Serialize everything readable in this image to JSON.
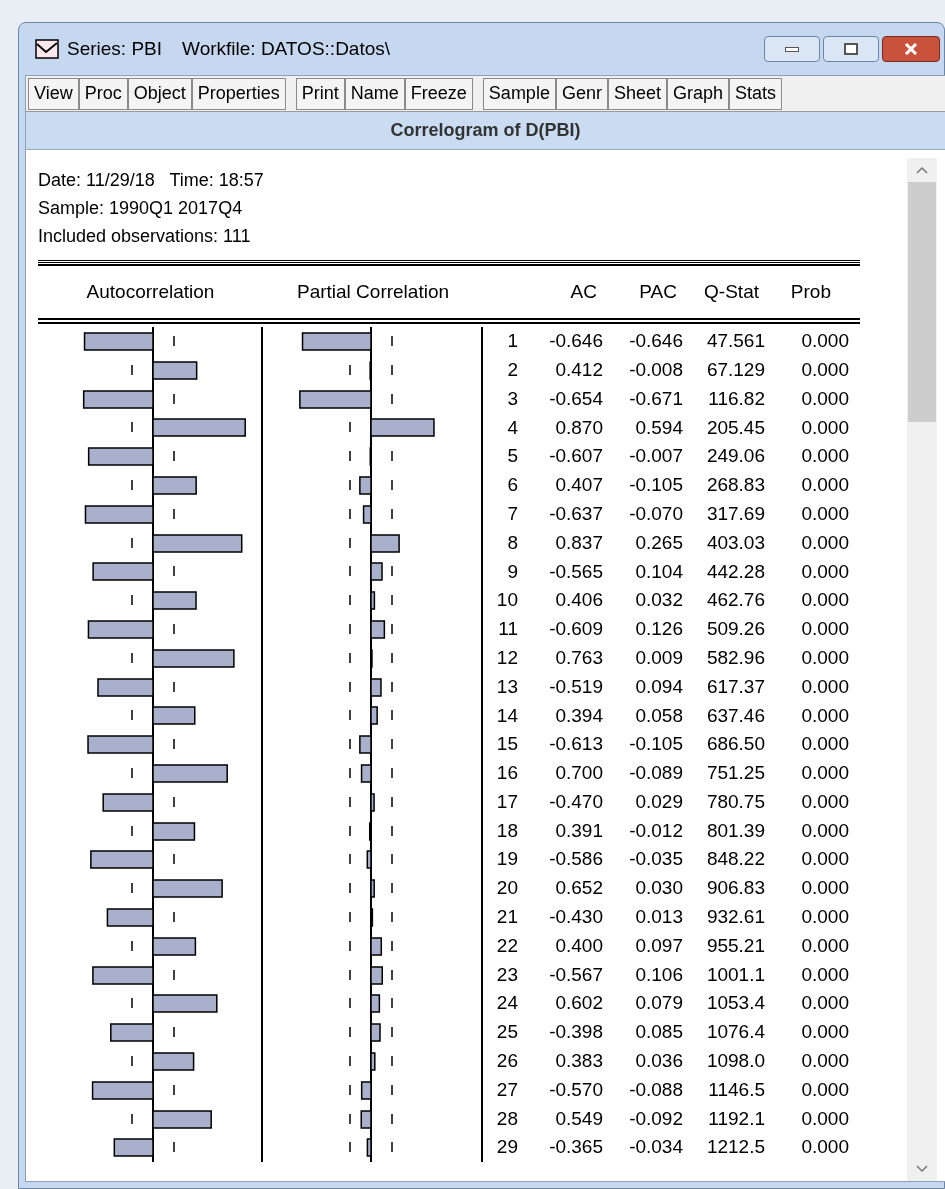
{
  "window": {
    "series": "Series: PBI",
    "workfile": "Workfile: DATOS::Datos\\"
  },
  "toolbar_groups": [
    [
      "View",
      "Proc",
      "Object",
      "Properties"
    ],
    [
      "Print",
      "Name",
      "Freeze"
    ],
    [
      "Sample",
      "Genr",
      "Sheet",
      "Graph",
      "Stats"
    ]
  ],
  "view_title": "Correlogram of D(PBI)",
  "header_lines": [
    "Date: 11/29/18   Time: 18:57",
    "Sample: 1990Q1 2017Q4",
    "Included observations: 111"
  ],
  "columns": [
    "Autocorrelation",
    "Partial Correlation",
    "AC",
    "PAC",
    "Q-Stat",
    "Prob"
  ],
  "rows": [
    {
      "lag": "1",
      "ac": "-0.646",
      "pac": "-0.646",
      "q_stat": "47.561",
      "prob": "0.000"
    },
    {
      "lag": "2",
      "ac": "0.412",
      "pac": "-0.008",
      "q_stat": "67.129",
      "prob": "0.000"
    },
    {
      "lag": "3",
      "ac": "-0.654",
      "pac": "-0.671",
      "q_stat": "116.82",
      "prob": "0.000"
    },
    {
      "lag": "4",
      "ac": "0.870",
      "pac": "0.594",
      "q_stat": "205.45",
      "prob": "0.000"
    },
    {
      "lag": "5",
      "ac": "-0.607",
      "pac": "-0.007",
      "q_stat": "249.06",
      "prob": "0.000"
    },
    {
      "lag": "6",
      "ac": "0.407",
      "pac": "-0.105",
      "q_stat": "268.83",
      "prob": "0.000"
    },
    {
      "lag": "7",
      "ac": "-0.637",
      "pac": "-0.070",
      "q_stat": "317.69",
      "prob": "0.000"
    },
    {
      "lag": "8",
      "ac": "0.837",
      "pac": "0.265",
      "q_stat": "403.03",
      "prob": "0.000"
    },
    {
      "lag": "9",
      "ac": "-0.565",
      "pac": "0.104",
      "q_stat": "442.28",
      "prob": "0.000"
    },
    {
      "lag": "10",
      "ac": "0.406",
      "pac": "0.032",
      "q_stat": "462.76",
      "prob": "0.000"
    },
    {
      "lag": "11",
      "ac": "-0.609",
      "pac": "0.126",
      "q_stat": "509.26",
      "prob": "0.000"
    },
    {
      "lag": "12",
      "ac": "0.763",
      "pac": "0.009",
      "q_stat": "582.96",
      "prob": "0.000"
    },
    {
      "lag": "13",
      "ac": "-0.519",
      "pac": "0.094",
      "q_stat": "617.37",
      "prob": "0.000"
    },
    {
      "lag": "14",
      "ac": "0.394",
      "pac": "0.058",
      "q_stat": "637.46",
      "prob": "0.000"
    },
    {
      "lag": "15",
      "ac": "-0.613",
      "pac": "-0.105",
      "q_stat": "686.50",
      "prob": "0.000"
    },
    {
      "lag": "16",
      "ac": "0.700",
      "pac": "-0.089",
      "q_stat": "751.25",
      "prob": "0.000"
    },
    {
      "lag": "17",
      "ac": "-0.470",
      "pac": "0.029",
      "q_stat": "780.75",
      "prob": "0.000"
    },
    {
      "lag": "18",
      "ac": "0.391",
      "pac": "-0.012",
      "q_stat": "801.39",
      "prob": "0.000"
    },
    {
      "lag": "19",
      "ac": "-0.586",
      "pac": "-0.035",
      "q_stat": "848.22",
      "prob": "0.000"
    },
    {
      "lag": "20",
      "ac": "0.652",
      "pac": "0.030",
      "q_stat": "906.83",
      "prob": "0.000"
    },
    {
      "lag": "21",
      "ac": "-0.430",
      "pac": "0.013",
      "q_stat": "932.61",
      "prob": "0.000"
    },
    {
      "lag": "22",
      "ac": "0.400",
      "pac": "0.097",
      "q_stat": "955.21",
      "prob": "0.000"
    },
    {
      "lag": "23",
      "ac": "-0.567",
      "pac": "0.106",
      "q_stat": "1001.1",
      "prob": "0.000"
    },
    {
      "lag": "24",
      "ac": "0.602",
      "pac": "0.079",
      "q_stat": "1053.4",
      "prob": "0.000"
    },
    {
      "lag": "25",
      "ac": "-0.398",
      "pac": "0.085",
      "q_stat": "1076.4",
      "prob": "0.000"
    },
    {
      "lag": "26",
      "ac": "0.383",
      "pac": "0.036",
      "q_stat": "1098.0",
      "prob": "0.000"
    },
    {
      "lag": "27",
      "ac": "-0.570",
      "pac": "-0.088",
      "q_stat": "1146.5",
      "prob": "0.000"
    },
    {
      "lag": "28",
      "ac": "0.549",
      "pac": "-0.092",
      "q_stat": "1192.1",
      "prob": "0.000"
    },
    {
      "lag": "29",
      "ac": "-0.365",
      "pac": "-0.034",
      "q_stat": "1212.5",
      "prob": "0.000"
    }
  ]
}
